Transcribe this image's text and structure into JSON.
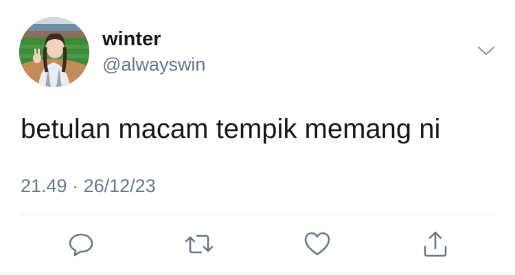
{
  "tweet": {
    "display_name": "winter",
    "handle": "@alwayswin",
    "text": "betulan macam tempik memang ni",
    "time": "21.49",
    "separator": "·",
    "date": "26/12/23"
  },
  "icons": {
    "menu": "chevron-down-icon",
    "reply": "reply-icon",
    "retweet": "retweet-icon",
    "like": "heart-icon",
    "share": "share-icon"
  },
  "colors": {
    "text_primary": "#14171a",
    "text_secondary": "#657786",
    "icon": "#657786",
    "divider": "#e1e8ed"
  }
}
